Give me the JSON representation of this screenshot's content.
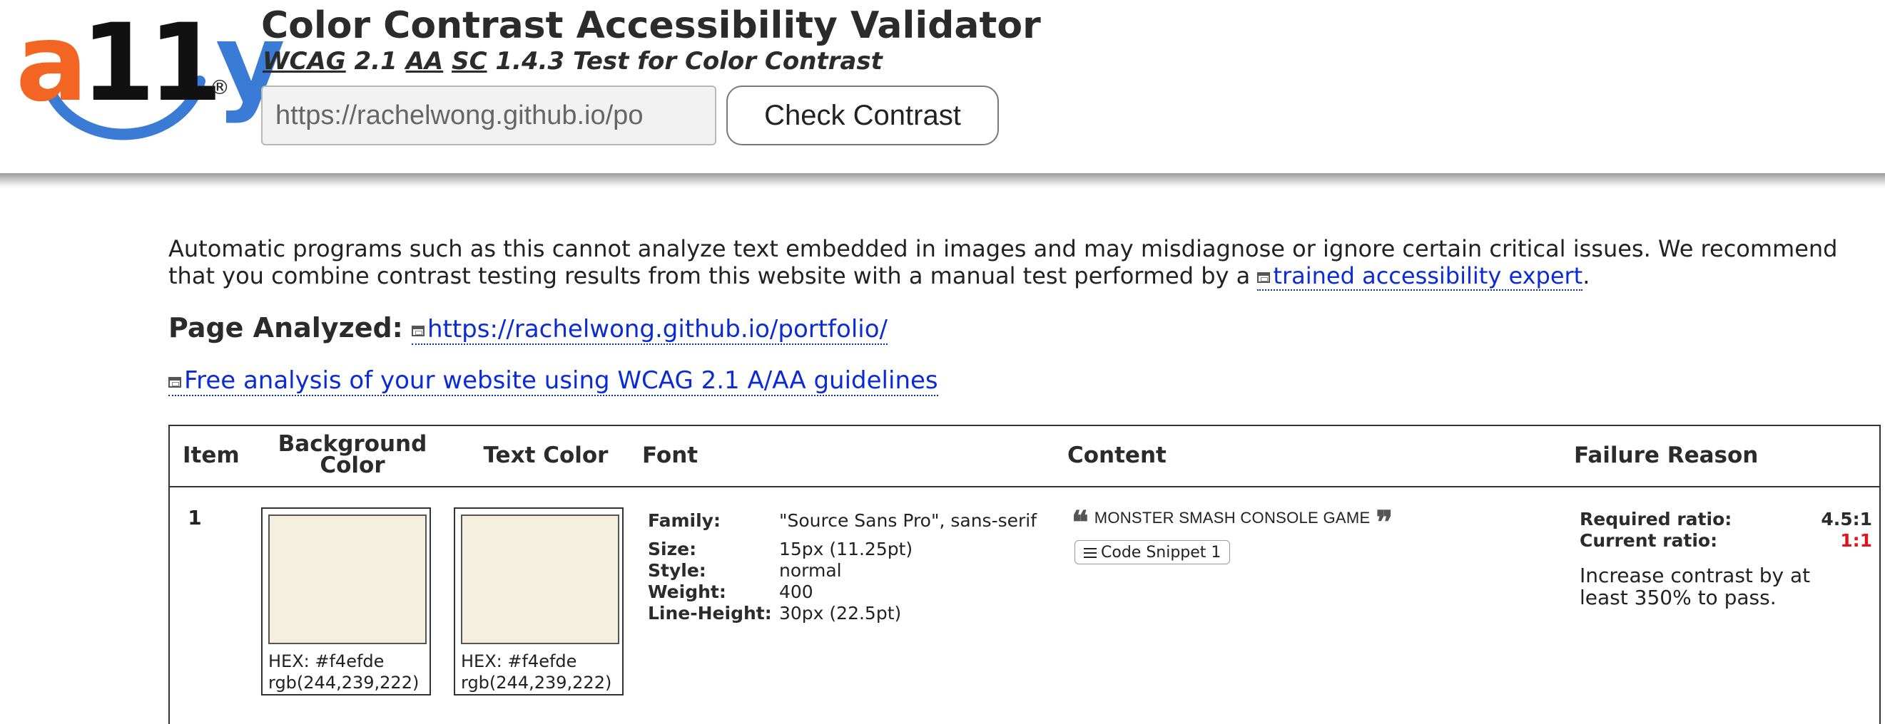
{
  "logo": {
    "a": "a",
    "eleven": "11",
    "y": "y",
    "registered": "®"
  },
  "header": {
    "title": "Color Contrast Accessibility Validator",
    "subtitle_parts": [
      "WCAG",
      " 2.1 ",
      "AA",
      " ",
      "SC",
      " 1.4.3 Test for Color Contrast"
    ],
    "url_value": "https://rachelwong.github.io/po",
    "check_button_label": "Check Contrast"
  },
  "main": {
    "disclaimer_text": "Automatic programs such as this cannot analyze text embedded in images and may misdiagnose or ignore certain critical issues. We recommend that you combine contrast testing results from this website with a manual test performed by a ",
    "disclaimer_link": "trained accessibility expert",
    "disclaimer_end": ".",
    "page_analyzed_label": "Page Analyzed:",
    "page_analyzed_url": "https://rachelwong.github.io/portfolio/",
    "free_analysis_link": "Free analysis of your website using WCAG 2.1 A/AA guidelines"
  },
  "table": {
    "headers": {
      "item": "Item",
      "background": "Background Color",
      "text_color": "Text Color",
      "font": "Font",
      "content": "Content",
      "failure": "Failure Reason"
    },
    "rows": [
      {
        "item": "1",
        "background": {
          "hex": "HEX: #f4efde",
          "rgb": "rgb(244,239,222)",
          "color": "#f4efde"
        },
        "text_color": {
          "hex": "HEX: #f4efde",
          "rgb": "rgb(244,239,222)",
          "color": "#f4efde"
        },
        "font": {
          "family_label": "Family:",
          "family": "\"Source Sans Pro\", sans-serif",
          "size_label": "Size:",
          "size": "15px (11.25pt)",
          "style_label": "Style:",
          "style": "normal",
          "weight_label": "Weight:",
          "weight": "400",
          "line_height_label": "Line-Height:",
          "line_height": "30px (22.5pt)"
        },
        "content": {
          "open_quote": "❝",
          "text": "MONSTER SMASH CONSOLE GAME",
          "close_quote": "❞",
          "snippet_label": "Code Snippet 1"
        },
        "failure": {
          "required_label": "Required ratio:",
          "required": "4.5:1",
          "current_label": "Current ratio:",
          "current": "1:1",
          "advice": "Increase contrast by at least 350% to pass."
        }
      }
    ]
  }
}
